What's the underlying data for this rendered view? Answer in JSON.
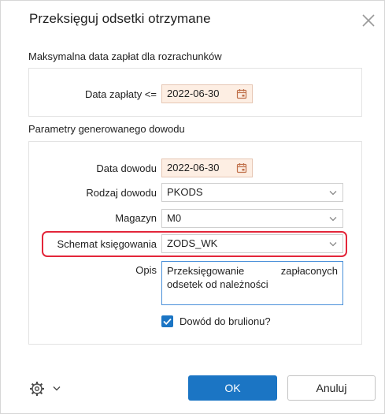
{
  "dialog": {
    "title": "Przeksięguj odsetki otrzymane",
    "close_icon": "close-icon"
  },
  "section1": {
    "title": "Maksymalna data zapłat dla rozrachunków",
    "payment_date_label": "Data zapłaty <=",
    "payment_date_value": "2022-06-30"
  },
  "section2": {
    "title": "Parametry generowanego dowodu",
    "doc_date_label": "Data dowodu",
    "doc_date_value": "2022-06-30",
    "doc_type_label": "Rodzaj dowodu",
    "doc_type_value": "PKODS",
    "warehouse_label": "Magazyn",
    "warehouse_value": "M0",
    "scheme_label": "Schemat księgowania",
    "scheme_value": "ZODS_WK",
    "desc_label": "Opis",
    "desc_value": "Przeksięgowanie zapłaconych odsetek od należności",
    "draft_label": "Dowód do brulionu?",
    "draft_checked": true
  },
  "footer": {
    "ok_label": "OK",
    "cancel_label": "Anuluj",
    "settings_icon": "gear-icon"
  },
  "colors": {
    "accent": "#1b75c4",
    "highlight": "#e3263a",
    "date_field_bg": "#fdeee3"
  }
}
